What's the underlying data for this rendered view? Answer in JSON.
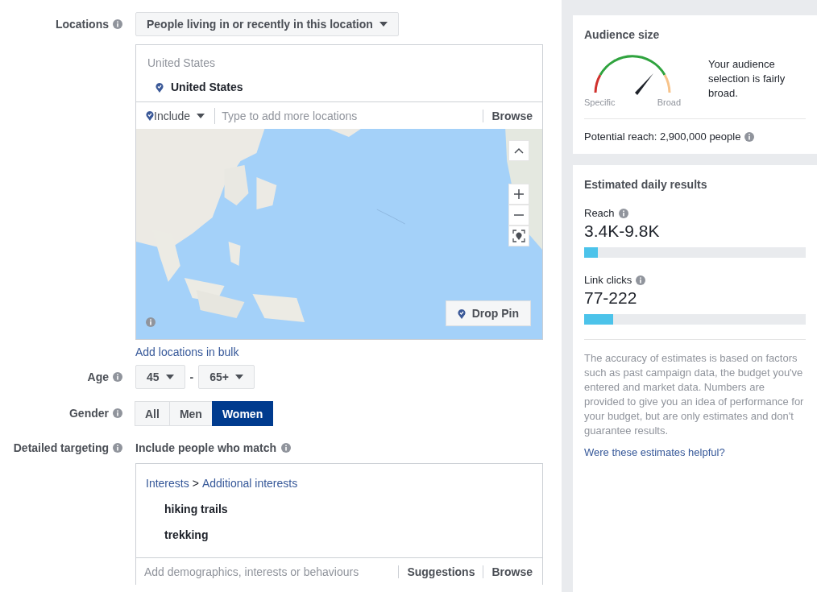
{
  "form": {
    "locations": {
      "label": "Locations",
      "type_select": "People living in or recently in this location",
      "selected_header": "United States",
      "selected_items": [
        "United States"
      ],
      "include_select": "Include",
      "search_placeholder": "Type to add more locations",
      "browse": "Browse",
      "drop_pin": "Drop Pin",
      "bulk_link": "Add locations in bulk"
    },
    "age": {
      "label": "Age",
      "min": "45",
      "separator": "-",
      "max": "65+"
    },
    "gender": {
      "label": "Gender",
      "options": [
        {
          "label": "All",
          "selected": false
        },
        {
          "label": "Men",
          "selected": false
        },
        {
          "label": "Women",
          "selected": true
        }
      ]
    },
    "detailed_targeting": {
      "label": "Detailed targeting",
      "sub_label": "Include people who match",
      "path": [
        "Interests",
        "Additional interests"
      ],
      "path_separator": ">",
      "items": [
        "hiking trails",
        "trekking"
      ],
      "placeholder": "Add demographics, interests or behaviours",
      "suggestions": "Suggestions",
      "browse": "Browse"
    }
  },
  "audience_size": {
    "title": "Audience size",
    "gauge_min": "Specific",
    "gauge_max": "Broad",
    "description": "Your audience selection is fairly broad.",
    "potential_reach": "Potential reach: 2,900,000 people"
  },
  "estimated_daily_results": {
    "title": "Estimated daily results",
    "metrics": [
      {
        "label": "Reach",
        "value": "3.4K-9.8K",
        "level": 0.06
      },
      {
        "label": "Link clicks",
        "value": "77-222",
        "level": 0.13
      }
    ],
    "disclaimer": "The accuracy of estimates is based on factors such as past campaign data, the budget you've entered and market data. Numbers are provided to give you an idea of performance for your budget, but are only estimates and don't guarantee results.",
    "feedback_link": "Were these estimates helpful?"
  }
}
